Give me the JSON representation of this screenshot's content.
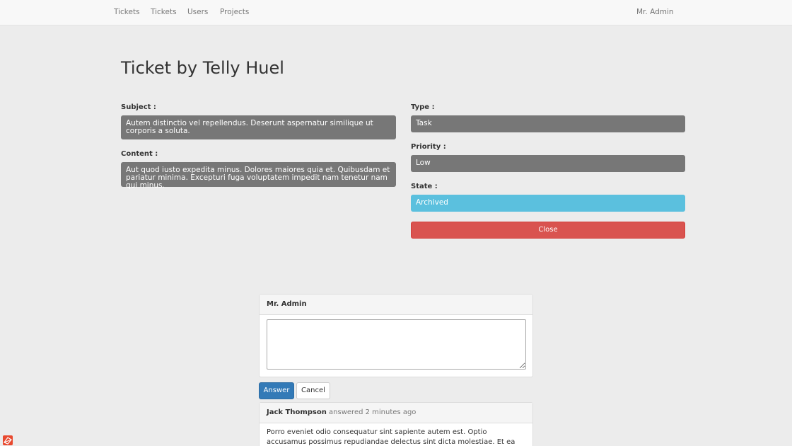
{
  "navbar": {
    "links": [
      "Tickets",
      "Tickets",
      "Users",
      "Projects"
    ],
    "user": "Mr. Admin"
  },
  "ticket": {
    "title": "Ticket by Telly Huel",
    "subject_label": "Subject :",
    "subject": "Autem distinctio vel repellendus. Deserunt aspernatur similique ut corporis a soluta.",
    "content_label": "Content :",
    "content": "Aut quod iusto expedita minus. Dolores maiores quia et. Quibusdam et pariatur minima. Excepturi fuga voluptatem impedit nam tenetur nam qui minus.",
    "type_label": "Type :",
    "type": "Task",
    "priority_label": "Priority :",
    "priority": "Low",
    "state_label": "State :",
    "state": "Archived",
    "close_label": "Close"
  },
  "reply": {
    "author": "Mr. Admin",
    "textarea_value": "",
    "answer_label": "Answer",
    "cancel_label": "Cancel"
  },
  "answers": [
    {
      "author": "Jack Thompson",
      "meta": "answered 2 minutes ago",
      "body": "Porro eveniet odio consequatur sint sapiente autem est. Optio accusamus possimus repudiandae delectus sint dicta molestiae. Et ea ipsam cum."
    }
  ],
  "colors": {
    "state_archived": "#5bc0de",
    "close_button": "#d9534f",
    "primary_button": "#337ab7",
    "field_background": "#777777"
  },
  "icons": {
    "corner": "app-logo-icon"
  }
}
